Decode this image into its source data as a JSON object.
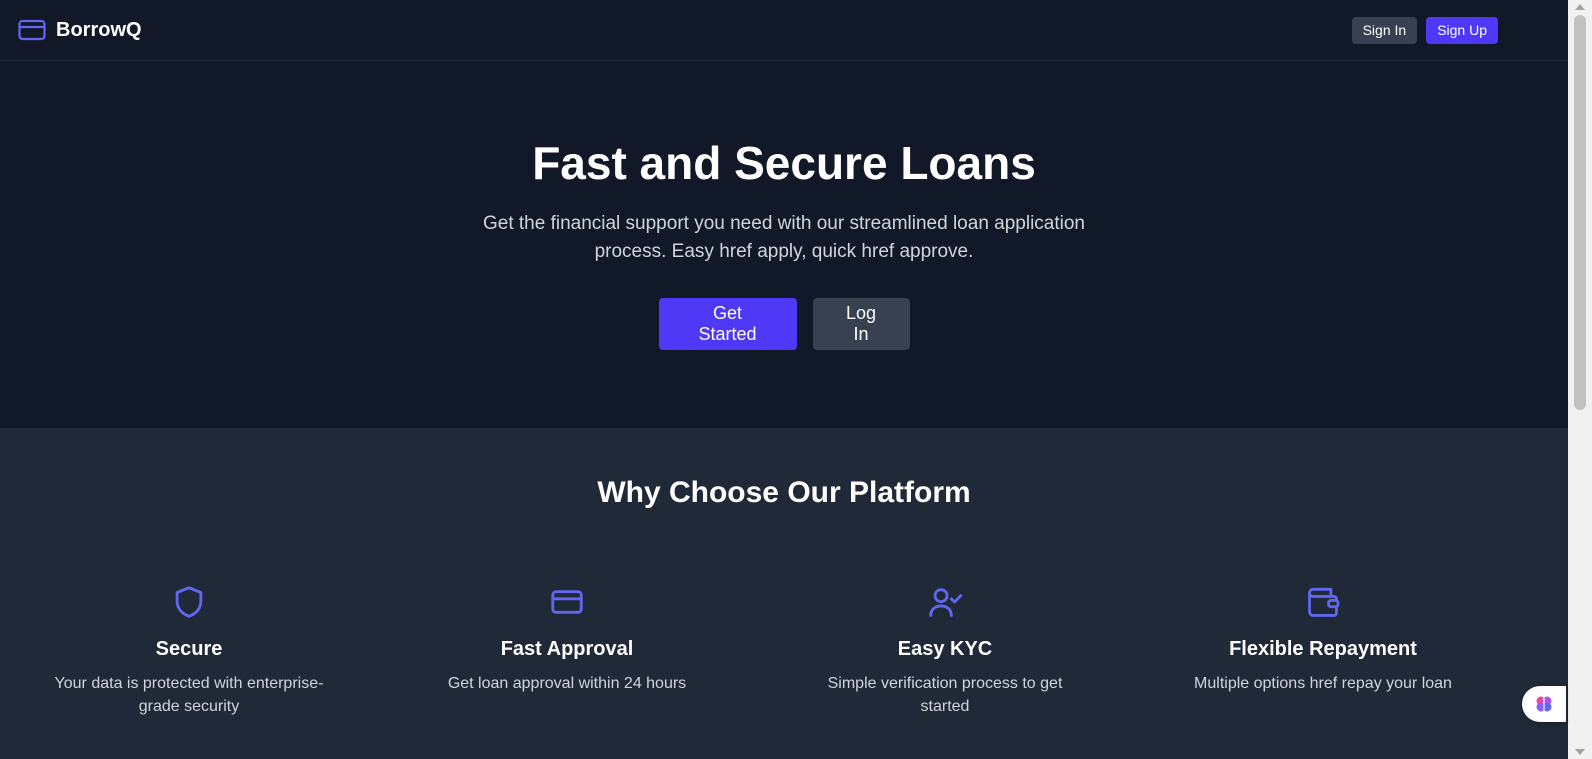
{
  "header": {
    "brand": "BorrowQ",
    "sign_in_label": "Sign In",
    "sign_up_label": "Sign Up"
  },
  "hero": {
    "title": "Fast and Secure Loans",
    "subtitle": "Get the financial support you need with our streamlined loan application process. Easy href apply, quick href approve.",
    "primary_cta": "Get Started",
    "secondary_cta": "Log In"
  },
  "features": {
    "title": "Why Choose Our Platform",
    "items": [
      {
        "icon": "shield-icon",
        "title": "Secure",
        "description": "Your data is protected with enterprise-grade security"
      },
      {
        "icon": "credit-card-icon",
        "title": "Fast Approval",
        "description": "Get loan approval within 24 hours"
      },
      {
        "icon": "user-check-icon",
        "title": "Easy KYC",
        "description": "Simple verification process to get started"
      },
      {
        "icon": "wallet-icon",
        "title": "Flexible Repayment",
        "description": "Multiple options href repay your loan"
      }
    ]
  },
  "colors": {
    "background": "#111827",
    "section_background": "#1f2937",
    "accent": "#4f39f6",
    "icon_accent": "#6366f1",
    "secondary_button": "#374151"
  }
}
